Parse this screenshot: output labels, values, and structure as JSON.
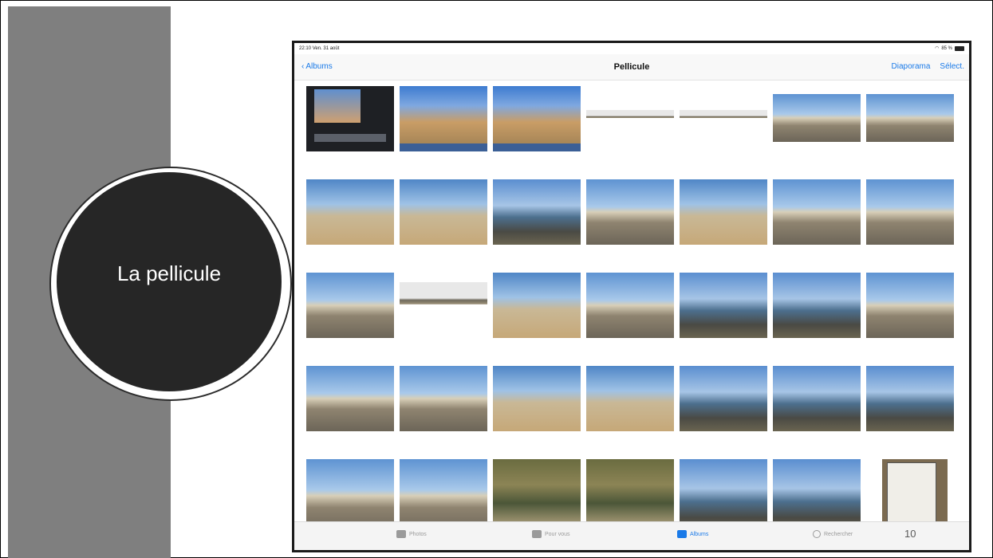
{
  "slide": {
    "title": "La pellicule",
    "page_number": "10"
  },
  "ipad": {
    "status": {
      "time": "22:10",
      "date": "Ven. 31 août",
      "battery": "85 %"
    },
    "nav": {
      "back_label": "Albums",
      "title": "Pellicule",
      "slideshow_label": "Diaporama",
      "select_label": "Sélect."
    },
    "tabs": [
      {
        "label": "Photos",
        "icon": "photos-icon",
        "active": false
      },
      {
        "label": "Pour vous",
        "icon": "for-you-icon",
        "active": false
      },
      {
        "label": "Albums",
        "icon": "albums-icon",
        "active": true
      },
      {
        "label": "Rechercher",
        "icon": "search-icon",
        "active": false
      }
    ],
    "photo_rows": [
      [
        "screen-recording",
        "home-screen",
        "home-screen",
        "panorama",
        "panorama",
        "rampart-beach",
        "rampart-beach"
      ],
      [
        "beach",
        "beach",
        "harbor",
        "rampart",
        "beach",
        "rampart",
        "rampart"
      ],
      [
        "rampart-walk",
        "panorama",
        "beach",
        "rampart",
        "harbor",
        "harbor",
        "rampart-walk"
      ],
      [
        "rampart-walk",
        "rampart-walk",
        "beach",
        "beach",
        "harbor",
        "harbor",
        "harbor"
      ],
      [
        "rampart",
        "rampart",
        "park-bench",
        "park-bench",
        "harbor-person",
        "harbor-person",
        "info-sign"
      ]
    ]
  },
  "colors": {
    "accent": "#1a7ae8",
    "band": "#7f7f7f",
    "circle": "#262626"
  }
}
